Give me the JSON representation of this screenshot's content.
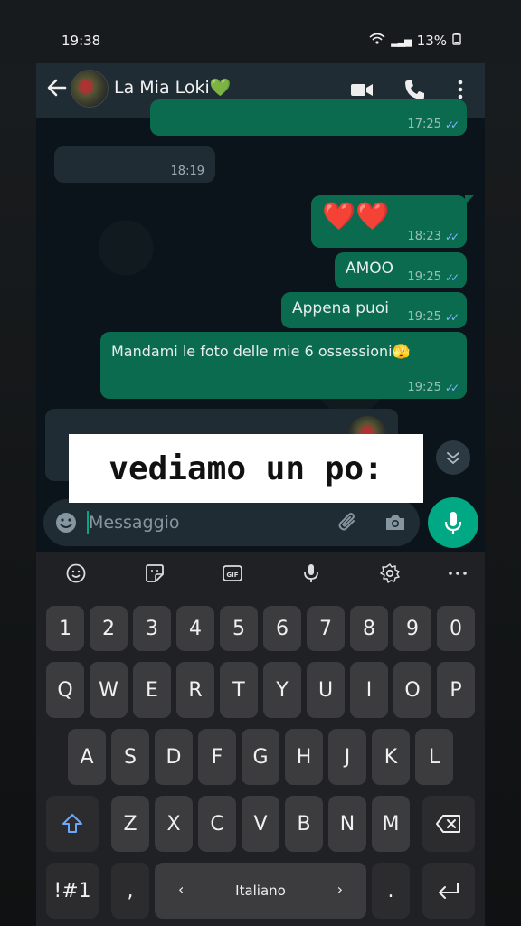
{
  "status": {
    "time": "19:38",
    "battery": "13%"
  },
  "header": {
    "contact_name": "La Mia Loki💚"
  },
  "messages": [
    {
      "id": "m0",
      "time": "17:25",
      "direction": "out",
      "text": ""
    },
    {
      "id": "m1",
      "time": "18:19",
      "direction": "in",
      "text": ""
    },
    {
      "id": "m2",
      "time": "18:23",
      "direction": "out",
      "text": "❤️❤️"
    },
    {
      "id": "m3",
      "time": "19:25",
      "direction": "out",
      "text": "AMOO"
    },
    {
      "id": "m4",
      "time": "19:25",
      "direction": "out",
      "text": "Appena puoi"
    },
    {
      "id": "m5",
      "time": "19:25",
      "direction": "out",
      "text": "Mandami le foto delle mie 6 ossessioni🫣"
    }
  ],
  "caption": "vediamo un po:",
  "input": {
    "placeholder": "Messaggio"
  },
  "keyboard": {
    "numbers": [
      "1",
      "2",
      "3",
      "4",
      "5",
      "6",
      "7",
      "8",
      "9",
      "0"
    ],
    "row1": [
      "Q",
      "W",
      "E",
      "R",
      "T",
      "Y",
      "U",
      "I",
      "O",
      "P"
    ],
    "row2": [
      "A",
      "S",
      "D",
      "F",
      "G",
      "H",
      "J",
      "K",
      "L"
    ],
    "row3": [
      "Z",
      "X",
      "C",
      "V",
      "B",
      "N",
      "M"
    ],
    "symbols_key": "!#1",
    "comma_key": ",",
    "space_label": "Italiano",
    "period_key": "."
  }
}
